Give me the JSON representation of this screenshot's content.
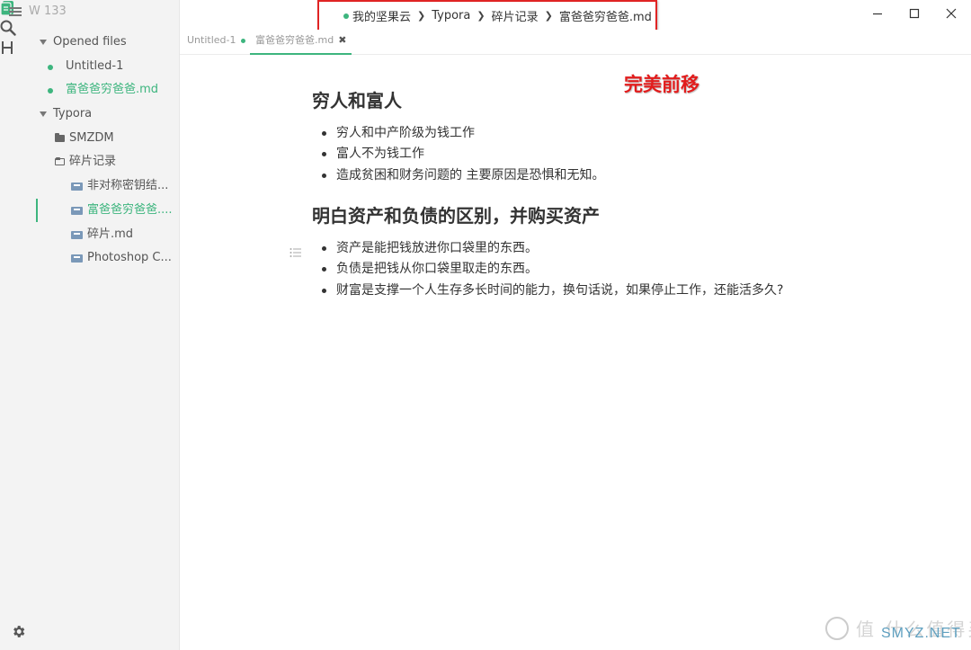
{
  "window": {
    "workspace_label": "W 133",
    "breadcrumb": [
      "我的坚果云",
      "Typora",
      "碎片记录",
      "富爸爸穷爸爸.md"
    ]
  },
  "sidebar": {
    "opened_files_label": "Opened files",
    "opened_files": [
      "Untitled-1",
      "富爸爸穷爸爸.md"
    ],
    "root_folder": "Typora",
    "folders": [
      "SMZDM",
      "碎片记录"
    ],
    "files": [
      "非对称密钥结...",
      "富爸爸穷爸爸....",
      "碎片.md",
      "Photoshop C..."
    ]
  },
  "tabs": [
    {
      "label": "Untitled-1"
    },
    {
      "label": "富爸爸穷爸爸.md"
    }
  ],
  "document": {
    "heading1": "穷人和富人",
    "list1": [
      "穷人和中产阶级为钱工作",
      "富人不为钱工作",
      "造成贫困和财务问题的 主要原因是恐惧和无知。"
    ],
    "heading2": "明白资产和负债的区别，并购买资产",
    "list2": [
      "资产是能把钱放进你口袋里的东西。",
      "负债是把钱从你口袋里取走的东西。",
      "财富是支撑一个人生存多长时间的能力，换句话说，如果停止工作，还能活多久?"
    ]
  },
  "annotation": "完美前移",
  "watermark": {
    "text": "值 什么值得买",
    "sub": "SMYZ.NET"
  },
  "colors": {
    "accent": "#3db57e",
    "highlight_box": "#e02424"
  },
  "icons": [
    "menu-icon",
    "files-icon",
    "search-icon",
    "heading-outline-icon",
    "settings-icon",
    "folder-icon",
    "markdown-file-icon",
    "minimize-icon",
    "maximize-icon",
    "close-icon",
    "outline-list-icon"
  ]
}
